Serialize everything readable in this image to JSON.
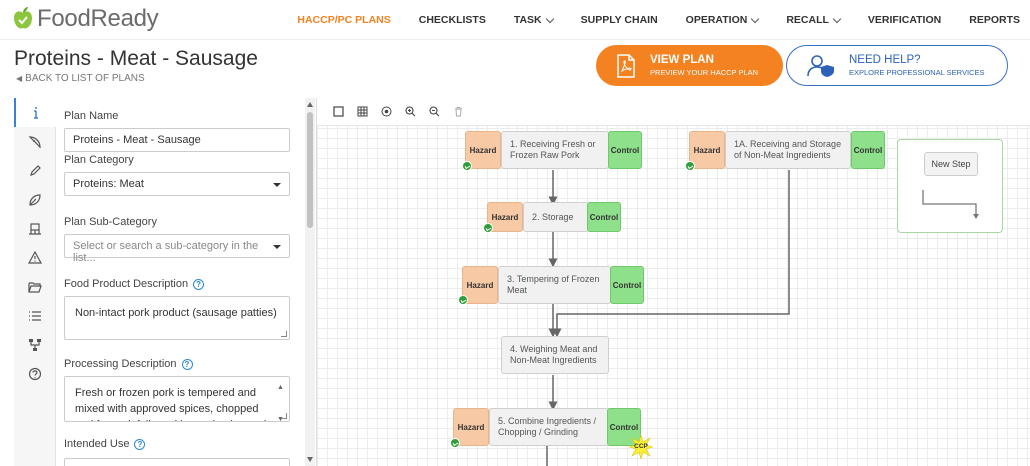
{
  "app": {
    "brand_name": "FoodReady",
    "brand_color": "#8cc63f"
  },
  "nav": {
    "items": [
      {
        "label": "HACCP/PC PLANS",
        "active": true,
        "dropdown": false
      },
      {
        "label": "CHECKLISTS",
        "active": false,
        "dropdown": false
      },
      {
        "label": "TASK",
        "active": false,
        "dropdown": true
      },
      {
        "label": "SUPPLY CHAIN",
        "active": false,
        "dropdown": false
      },
      {
        "label": "OPERATION",
        "active": false,
        "dropdown": true
      },
      {
        "label": "RECALL",
        "active": false,
        "dropdown": true
      },
      {
        "label": "VERIFICATION",
        "active": false,
        "dropdown": false
      },
      {
        "label": "REPORTS",
        "active": false,
        "dropdown": false
      }
    ],
    "accent_color": "#f58220"
  },
  "header": {
    "title": "Proteins - Meat - Sausage",
    "back_label": "BACK TO LIST OF PLANS",
    "view_plan": {
      "main": "VIEW PLAN",
      "sub": "PREVIEW YOUR HACCP PLAN"
    },
    "need_help": {
      "main": "NEED HELP?",
      "sub": "EXPLORE PROFESSIONAL SERVICES"
    }
  },
  "rail": {
    "icons": [
      "info-icon",
      "pizza-slice-icon",
      "pen-icon",
      "leaf-icon",
      "building-icon",
      "warning-icon",
      "folder-open-icon",
      "list-icon",
      "flowchart-icon",
      "help-circle-icon"
    ]
  },
  "form": {
    "plan_name_label": "Plan Name",
    "plan_name_value": "Proteins - Meat - Sausage",
    "plan_category_label": "Plan Category",
    "plan_category_value": "Proteins: Meat",
    "plan_subcategory_label": "Plan Sub-Category",
    "plan_subcategory_placeholder": "Select or search a sub-category in the list...",
    "food_product_label": "Food Product Description",
    "food_product_value": "Non-intact pork product (sausage patties)",
    "processing_label": "Processing Description",
    "processing_value": "Fresh or frozen pork is tempered and mixed with approved spices, chopped and formed, followed by packaging and",
    "intended_use_label": "Intended Use"
  },
  "canvas": {
    "new_step_label": "New Step",
    "hazard_label": "Hazard",
    "control_label": "Control",
    "ccp_label": "CCP",
    "steps": [
      {
        "label": "1. Receiving Fresh or Frozen Raw Pork"
      },
      {
        "label": "1A. Receiving and Storage of Non-Meat Ingredients"
      },
      {
        "label": "2. Storage"
      },
      {
        "label": "3. Tempering of Frozen Meat"
      },
      {
        "label": "4. Weighing Meat and Non-Meat Ingredients"
      },
      {
        "label": "5. Combine Ingredients / Chopping / Grinding"
      }
    ],
    "hazard_color": "#f7c9a4",
    "control_color": "#8ee08a",
    "ccp_color": "#f9ef3a"
  }
}
